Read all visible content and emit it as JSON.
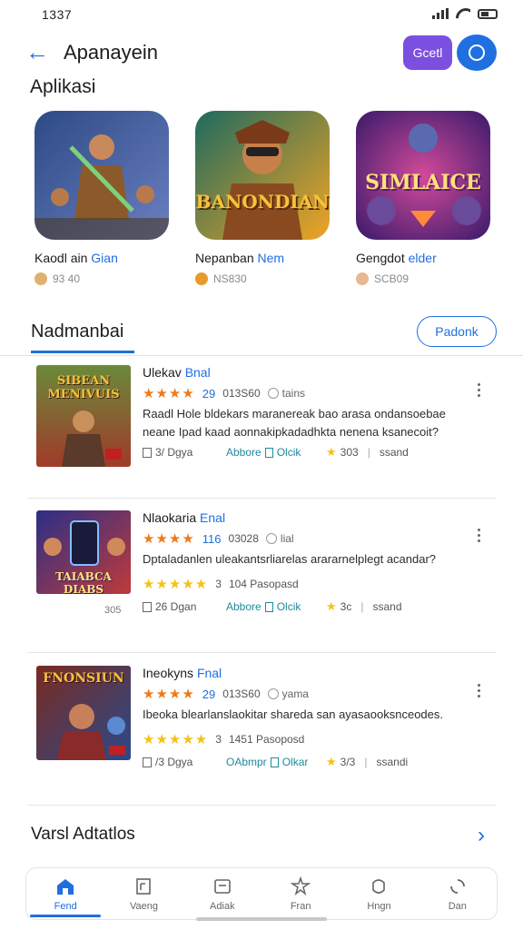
{
  "status_bar": {
    "time": "1337"
  },
  "header": {
    "title": "Apanayein",
    "action_label": "Gcetl"
  },
  "apps_section": {
    "title": "Aplikasi",
    "apps": [
      {
        "name": "Kaodl ain",
        "name_accent": "Gian",
        "meta": "93 40",
        "coin_color": "#e0b070",
        "art_title": "",
        "colors": [
          "#2d4a86",
          "#6b7fc0"
        ]
      },
      {
        "name": "Nepanban",
        "name_accent": "Nem",
        "meta": "NS830",
        "coin_color": "#e89a2a",
        "art_title": "BANONDIAN",
        "colors": [
          "#1d6a5f",
          "#f0a424"
        ]
      },
      {
        "name": "Gengdot",
        "name_accent": "elder",
        "meta": "SCB09",
        "coin_color": "#e8b890",
        "art_title": "SIMLAICE",
        "colors": [
          "#3a1a6a",
          "#d24a9a"
        ]
      }
    ]
  },
  "tabs": {
    "active_tab": "Nadmanbai",
    "filter_label": "Padonk"
  },
  "list": [
    {
      "title": "Ulekav",
      "title_accent": "Bnal",
      "stars": "★★★★",
      "rating": "29",
      "count": "013S60",
      "tag": "tains",
      "description": "Raadl Hole bldekars maranereak bao arasa ondansoebae neane Ipad kaad aonnakipkadadhkta nenena ksanecoit?",
      "stars2": "",
      "foot_a": "3/ Dgya",
      "foot_b": "Abbore",
      "foot_b2": "Olcik",
      "foot_c": "303",
      "foot_c2": "ssand",
      "thumb_title": "SIBEAN MENIVUIS",
      "thumb_sub": "",
      "colors": [
        "#6a8a3a",
        "#a03a2a"
      ]
    },
    {
      "title": "Nlaokaria",
      "title_accent": "Enal",
      "stars": "★★★★",
      "rating": "116",
      "count": "03028",
      "tag": "lial",
      "description": "Dptaladanlen uleakantsrliarelas arararnelplegt acandar?",
      "stars2": "★★★★★",
      "rating2": "3",
      "rating2_extra": "104 Pasopasd",
      "foot_a": "26 Dgan",
      "foot_b": "Abbore",
      "foot_b2": "Olcik",
      "foot_c": "3c",
      "foot_c2": "ssand",
      "thumb_title": "TAIABCA DIABS",
      "thumb_sub": "305",
      "colors": [
        "#2a2f86",
        "#c03a3a"
      ]
    },
    {
      "title": "Ineokyns",
      "title_accent": "Fnal",
      "stars": "★★★★",
      "rating": "29",
      "count": "013S60",
      "tag": "yama",
      "description": "Ibeoka blearlanslaokitar shareda san ayasaooksnceodes.",
      "stars2": "★★★★★",
      "rating2": "3",
      "rating2_extra": "1451 Pasoposd",
      "foot_a": "/3 Dgya",
      "foot_b": "OAbmpr",
      "foot_b2": "Olkar",
      "foot_c": "3/3",
      "foot_c2": "ssandi",
      "thumb_title": "FNONSIUN",
      "thumb_sub": "",
      "colors": [
        "#7a2a20",
        "#2a4a8a"
      ]
    }
  ],
  "recent": {
    "title": "Varsl Adtatlos"
  },
  "bottom_nav": [
    {
      "label": "Fend",
      "icon": "home-icon"
    },
    {
      "label": "Vaeng",
      "icon": "document-icon"
    },
    {
      "label": "Adiak",
      "icon": "tv-icon"
    },
    {
      "label": "Fran",
      "icon": "puzzle-icon"
    },
    {
      "label": "Hngn",
      "icon": "shield-icon"
    },
    {
      "label": "Dan",
      "icon": "loader-icon"
    }
  ]
}
